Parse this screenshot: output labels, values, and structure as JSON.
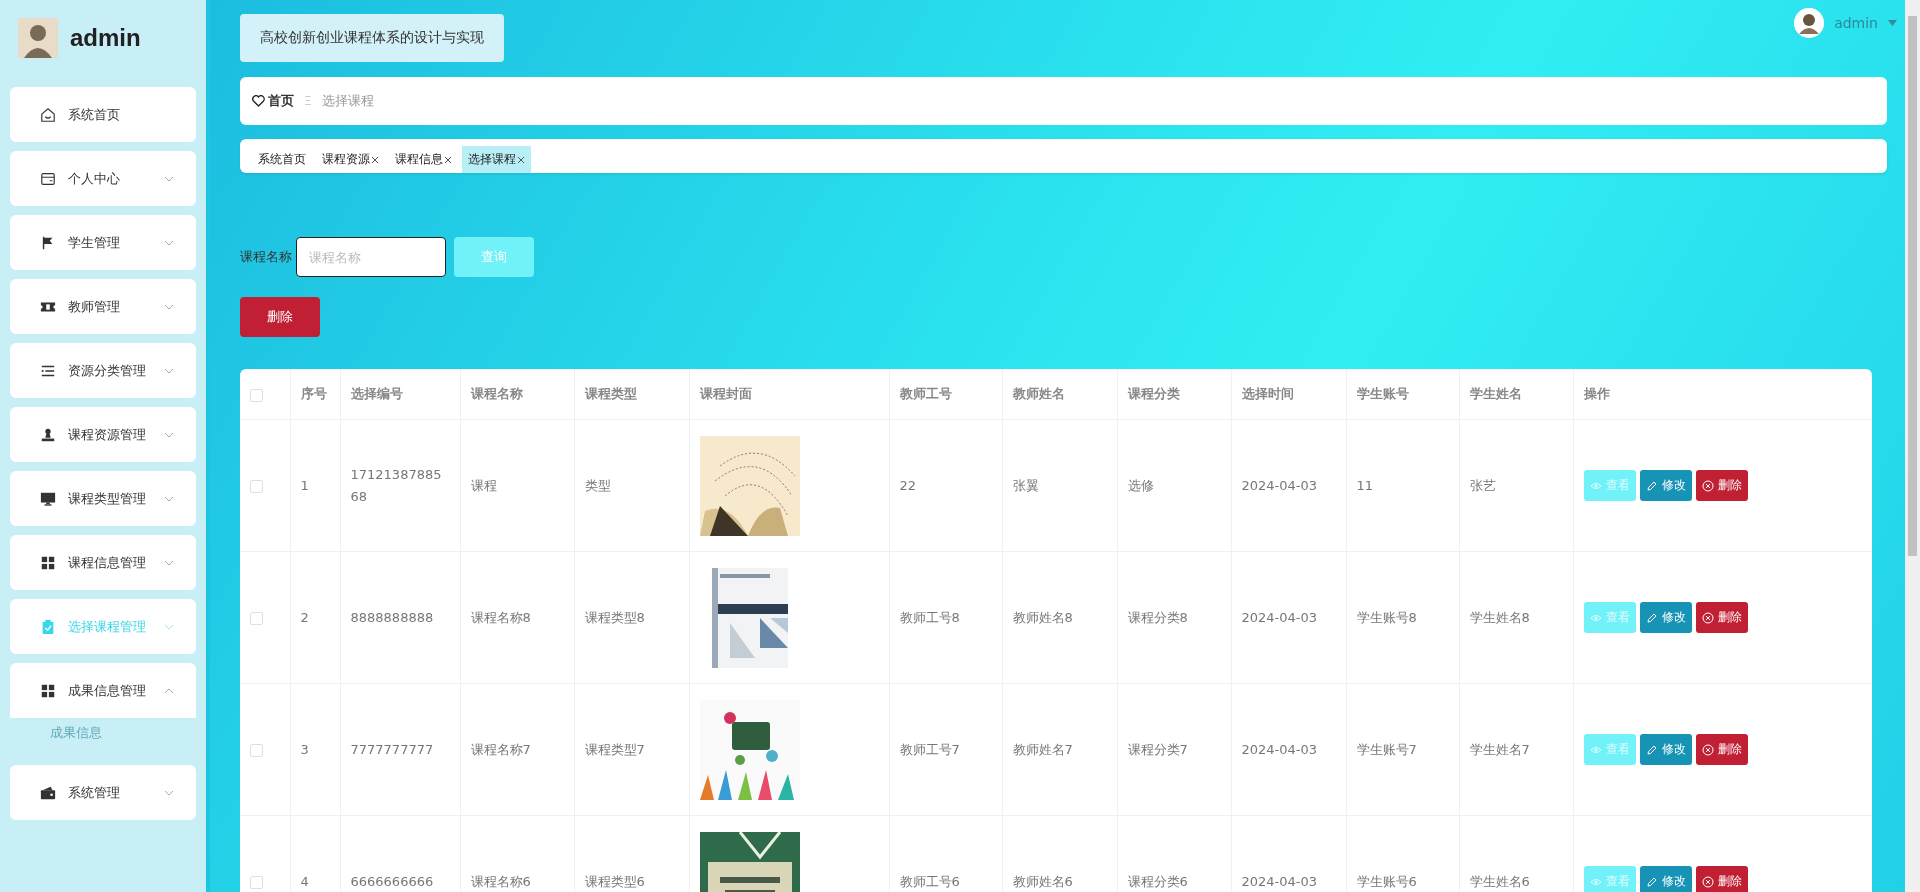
{
  "sidebar": {
    "user": "admin",
    "items": [
      {
        "label": "系统首页",
        "has_children": false,
        "expanded": false,
        "selected": false
      },
      {
        "label": "个人中心",
        "has_children": true,
        "expanded": false,
        "selected": false
      },
      {
        "label": "学生管理",
        "has_children": true,
        "expanded": false,
        "selected": false
      },
      {
        "label": "教师管理",
        "has_children": true,
        "expanded": false,
        "selected": false
      },
      {
        "label": "资源分类管理",
        "has_children": true,
        "expanded": false,
        "selected": false
      },
      {
        "label": "课程资源管理",
        "has_children": true,
        "expanded": false,
        "selected": false
      },
      {
        "label": "课程类型管理",
        "has_children": true,
        "expanded": false,
        "selected": false
      },
      {
        "label": "课程信息管理",
        "has_children": true,
        "expanded": false,
        "selected": false
      },
      {
        "label": "选择课程管理",
        "has_children": true,
        "expanded": false,
        "selected": true
      },
      {
        "label": "成果信息管理",
        "has_children": true,
        "expanded": true,
        "selected": false,
        "children": [
          {
            "label": "成果信息",
            "hovered": true
          }
        ]
      },
      {
        "label": "系统管理",
        "has_children": true,
        "expanded": false,
        "selected": false
      }
    ]
  },
  "header": {
    "title": "高校创新创业课程体系的设计与实现",
    "user": "admin"
  },
  "breadcrumb": {
    "home": "首页",
    "separator": "Ξ",
    "current": "选择课程"
  },
  "tabs": [
    {
      "label": "系统首页",
      "closable": false,
      "selected": false
    },
    {
      "label": "课程资源",
      "closable": true,
      "selected": false
    },
    {
      "label": "课程信息",
      "closable": true,
      "selected": false
    },
    {
      "label": "选择课程",
      "closable": true,
      "selected": true
    }
  ],
  "search": {
    "label": "课程名称",
    "placeholder": "课程名称",
    "button": "查询"
  },
  "delete_button": "删除",
  "table": {
    "select_all_checked": false,
    "columns": [
      "序号",
      "选择编号",
      "课程名称",
      "课程类型",
      "课程封面",
      "教师工号",
      "教师姓名",
      "课程分类",
      "选择时间",
      "学生账号",
      "学生姓名",
      "操作"
    ],
    "rows": [
      {
        "checked": false,
        "cells": [
          "1",
          "1712138788568",
          "课程",
          "类型",
          "",
          "22",
          "张翼",
          "选修",
          "2024-04-03",
          "11",
          "张艺"
        ],
        "cover": {
          "kind": "picture"
        },
        "actions": [
          {
            "kind": "view",
            "label": "查看"
          },
          {
            "kind": "edit",
            "label": "修改"
          },
          {
            "kind": "delete",
            "label": "删除"
          }
        ]
      },
      {
        "checked": false,
        "cells": [
          "2",
          "8888888888",
          "课程名称8",
          "课程类型8",
          "",
          "教师工号8",
          "教师姓名8",
          "课程分类8",
          "2024-04-03",
          "学生账号8",
          "学生姓名8"
        ],
        "cover": {
          "kind": "picture"
        },
        "actions": [
          {
            "kind": "view",
            "label": "查看"
          },
          {
            "kind": "edit",
            "label": "修改"
          },
          {
            "kind": "delete",
            "label": "删除"
          }
        ]
      },
      {
        "checked": false,
        "cells": [
          "3",
          "7777777777",
          "课程名称7",
          "课程类型7",
          "",
          "教师工号7",
          "教师姓名7",
          "课程分类7",
          "2024-04-03",
          "学生账号7",
          "学生姓名7"
        ],
        "cover": {
          "kind": "picture"
        },
        "actions": [
          {
            "kind": "view",
            "label": "查看"
          },
          {
            "kind": "edit",
            "label": "修改"
          },
          {
            "kind": "delete",
            "label": "删除"
          }
        ]
      },
      {
        "checked": false,
        "cells": [
          "4",
          "6666666666",
          "课程名称6",
          "课程类型6",
          "",
          "教师工号6",
          "教师姓名6",
          "课程分类6",
          "2024-04-03",
          "学生账号6",
          "学生姓名6"
        ],
        "cover": {
          "kind": "picture"
        },
        "actions": [
          {
            "kind": "view",
            "label": "查看"
          },
          {
            "kind": "edit",
            "label": "修改"
          },
          {
            "kind": "delete",
            "label": "删除"
          }
        ]
      }
    ]
  }
}
